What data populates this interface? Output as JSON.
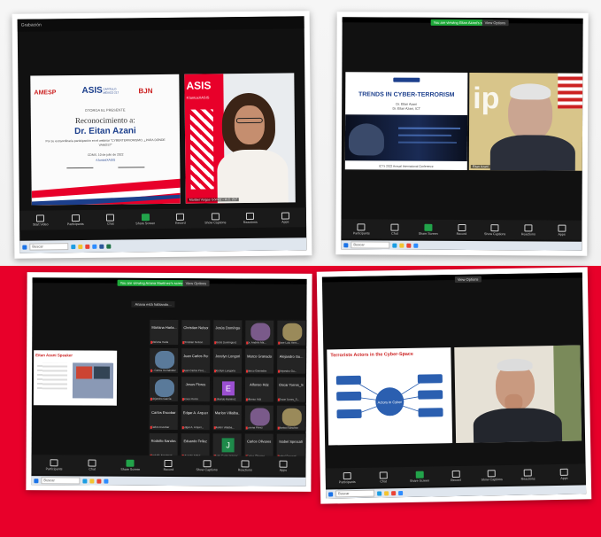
{
  "taskbar": {
    "search_placeholder": "Buscar"
  },
  "toolbar": {
    "audio": "Start Video",
    "participants": "Participants",
    "chat": "Chat",
    "share": "Share Screen",
    "record": "Record",
    "show_captions": "Show Captions",
    "apps": "Apps",
    "reactions": "Reactions",
    "end": "End"
  },
  "panel1": {
    "top_label": "Grabación",
    "certificate": {
      "org1": "AMESP",
      "org2": "ASIS",
      "org2_sub": "CAPÍTULO MÉXICO 217",
      "org3": "BJN",
      "grants": "OTORGA EL PRESENTE",
      "title": "Reconocimiento a:",
      "name": "Dr. Eitan Azani",
      "body": "Por su extraordinaria participación en el webinar \"CYBERTERRORISMO, ¿PARA DÓNDE VAMOS?\"",
      "date": "CDMX, 10 de julio de 2022",
      "hashtag": "#JuntosXASIS"
    },
    "banner_brand": "ASIS",
    "banner_tag": "#JuntosXASIS",
    "speaker_label": "Maribel Vargas Gómez – A.C. 217"
  },
  "panel2": {
    "green_banner": "You are viewing Eitan Azani's screen",
    "view_options": "View Options",
    "slide_title": "TRENDS IN CYBER-TERRORISM",
    "slide_author": "Dr. Eitan Azani",
    "slide_org": "Dr. Eitan Azani, ICT",
    "slide_footer": "ICT's 2022 Annual International Conference",
    "speaker_label": "Eitan Azani"
  },
  "panel3": {
    "green_banner": "You are viewing Ariana Martínez's screen",
    "view_options": "View Options",
    "slide_title": "Eitan Azani Speaker",
    "share_text": "Ariana está hablando...",
    "participants": [
      {
        "name": "Mariana Harla...",
        "sub": "Mariana Harla"
      },
      {
        "name": "Christian Nelson",
        "sub": "Christian Nelson"
      },
      {
        "name": "Jesús Domínguez",
        "sub": "Jesús Domínguez"
      },
      {
        "name": "",
        "sub": "Dr. Andrés Ma..."
      },
      {
        "name": "",
        "sub": "Jose Luis Hern..."
      },
      {
        "name": "",
        "sub": "L. Carlos Hernández"
      },
      {
        "name": "Juan Carlos Pere...",
        "sub": "Juan Carlos Pere..."
      },
      {
        "name": "Jocelyn Longoria",
        "sub": "Jocelyn Longoria"
      },
      {
        "name": "Marco Granados",
        "sub": "Marco Granados"
      },
      {
        "name": "Alejandro Gu...",
        "sub": "Alejandro Gu..."
      },
      {
        "name": "",
        "sub": "Alejandro García"
      },
      {
        "name": "Jesus Flores",
        "sub": "Jesus Flores"
      },
      {
        "name": "E",
        "sub": "Eduardo Ramírez"
      },
      {
        "name": "Alfonso Hdz",
        "sub": "Alfonso Hdz"
      },
      {
        "name": "Oscar Torres_S...",
        "sub": "Oscar Torres_S..."
      },
      {
        "name": "Carlos Escobar",
        "sub": "Carlos Escobar"
      },
      {
        "name": "Edgar A. Arquer...",
        "sub": "Edgar A. Arquer..."
      },
      {
        "name": "Marlon Villalba...",
        "sub": "Marlon Villalba..."
      },
      {
        "name": "",
        "sub": "Lorena Pérez"
      },
      {
        "name": "",
        "sub": "Marisol Sánchez"
      },
      {
        "name": "Rodolfo Sandoval",
        "sub": "Rodolfo Sandoval"
      },
      {
        "name": "Eduardo Tellez",
        "sub": "Eduardo Tellez"
      },
      {
        "name": "J",
        "sub": "Juan Carlos Ramos"
      },
      {
        "name": "Carlos Olivares",
        "sub": "Carlos Olivares"
      },
      {
        "name": "Isabel Sprocati",
        "sub": "Isabel Sprocati"
      }
    ]
  },
  "panel4": {
    "green_banner": "",
    "view_options": "View Options",
    "slide_title": "Terrorists Actors in the Cyber-Space",
    "center_node": "Actors in Cyber",
    "speaker_label": "Eitan Azani"
  }
}
